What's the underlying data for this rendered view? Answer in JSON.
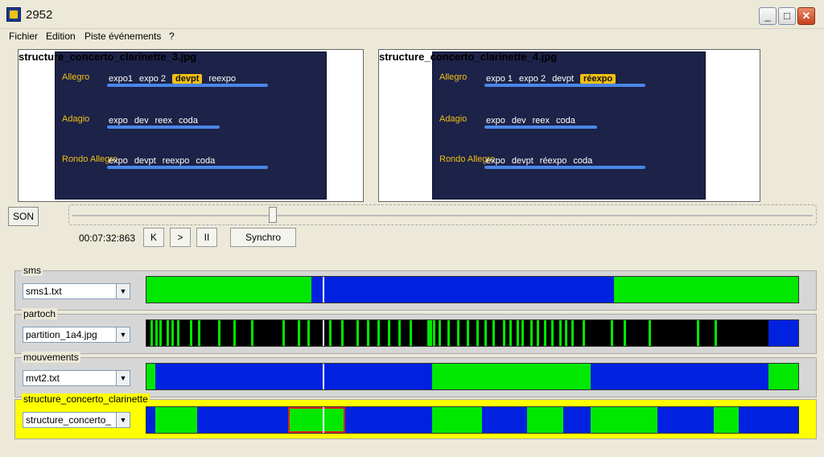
{
  "window": {
    "title": "2952"
  },
  "menu": {
    "items": [
      "Fichier",
      "Edition",
      "Piste événements",
      "?"
    ]
  },
  "images": {
    "left": {
      "caption": "structure_concerto_clarinette_3.jpg",
      "rows": [
        {
          "label": "Allegro",
          "items": [
            "expo1",
            "expo 2",
            "devpt",
            "reexpo"
          ],
          "highlight": 2
        },
        {
          "label": "Adagio",
          "items": [
            "expo",
            "dev",
            "reex",
            "coda"
          ],
          "highlight": -1
        },
        {
          "label": "Rondo Allegro",
          "items": [
            "expo",
            "devpt",
            "reexpo",
            "coda"
          ],
          "highlight": -1
        }
      ]
    },
    "right": {
      "caption": "structure_concerto_clarinette_4.jpg",
      "rows": [
        {
          "label": "Allegro",
          "items": [
            "expo 1",
            "expo 2",
            "devpt",
            "réexpo"
          ],
          "highlight": 3
        },
        {
          "label": "Adagio",
          "items": [
            "expo",
            "dev",
            "reex",
            "coda"
          ],
          "highlight": -1
        },
        {
          "label": "Rondo Allegro",
          "items": [
            "expo",
            "devpt",
            "réexpo",
            "coda"
          ],
          "highlight": -1
        }
      ]
    }
  },
  "player": {
    "son_label": "SON",
    "time": "00:07:32:863",
    "prev_label": "K",
    "play_label": ">",
    "pause_label": "II",
    "synchro_label": "Synchro",
    "position": 0.27
  },
  "colors": {
    "green": "#00e800",
    "blue": "#0022e0",
    "black": "#000000",
    "selected_track": "#ffff00"
  },
  "tracks": [
    {
      "name": "sms",
      "file": "sms1.txt",
      "selected": false,
      "segments": [
        {
          "start": 0.0,
          "end": 0.253,
          "color": "green"
        },
        {
          "start": 0.253,
          "end": 0.715,
          "color": "blue"
        },
        {
          "start": 0.715,
          "end": 1.0,
          "color": "green"
        }
      ]
    },
    {
      "name": "partoch",
      "file": "partition_1a4.jpg",
      "selected": false,
      "background": "black",
      "stripes": [
        0.006,
        0.014,
        0.02,
        0.031,
        0.038,
        0.047,
        0.066,
        0.079,
        0.109,
        0.133,
        0.16,
        0.208,
        0.232,
        0.246,
        0.279,
        0.298,
        0.321,
        0.337,
        0.353,
        0.37,
        0.385,
        0.403,
        0.43,
        0.434,
        0.438,
        0.447,
        0.461,
        0.475,
        0.49,
        0.505,
        0.517,
        0.53,
        0.546,
        0.556,
        0.566,
        0.574,
        0.588,
        0.597,
        0.608,
        0.62,
        0.632,
        0.64,
        0.65,
        0.668,
        0.71,
        0.73,
        0.768,
        0.842,
        0.87
      ],
      "tail": {
        "start": 0.952,
        "end": 1.0,
        "color": "blue"
      }
    },
    {
      "name": "mouvements",
      "file": "mvt2.txt",
      "selected": false,
      "segments": [
        {
          "start": 0.0,
          "end": 0.013,
          "color": "green"
        },
        {
          "start": 0.013,
          "end": 0.437,
          "color": "blue"
        },
        {
          "start": 0.437,
          "end": 0.68,
          "color": "green"
        },
        {
          "start": 0.68,
          "end": 0.952,
          "color": "blue"
        },
        {
          "start": 0.952,
          "end": 1.0,
          "color": "green"
        }
      ]
    },
    {
      "name": "structure_concerto_clarinette",
      "file": "structure_concerto_",
      "selected": true,
      "segments": [
        {
          "start": 0.0,
          "end": 0.013,
          "color": "blue"
        },
        {
          "start": 0.013,
          "end": 0.078,
          "color": "green"
        },
        {
          "start": 0.078,
          "end": 0.217,
          "color": "blue"
        },
        {
          "start": 0.217,
          "end": 0.304,
          "color": "green"
        },
        {
          "start": 0.304,
          "end": 0.437,
          "color": "blue"
        },
        {
          "start": 0.437,
          "end": 0.513,
          "color": "green"
        },
        {
          "start": 0.513,
          "end": 0.583,
          "color": "blue"
        },
        {
          "start": 0.583,
          "end": 0.638,
          "color": "green"
        },
        {
          "start": 0.638,
          "end": 0.68,
          "color": "blue"
        },
        {
          "start": 0.68,
          "end": 0.782,
          "color": "green"
        },
        {
          "start": 0.782,
          "end": 0.868,
          "color": "blue"
        },
        {
          "start": 0.868,
          "end": 0.906,
          "color": "green"
        },
        {
          "start": 0.906,
          "end": 1.0,
          "color": "blue"
        }
      ],
      "current_segment": 3
    }
  ]
}
